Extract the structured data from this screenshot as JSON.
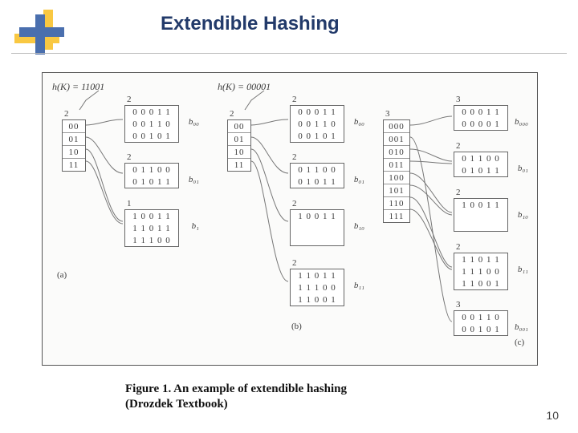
{
  "title": "Extendible Hashing",
  "caption_line1": "Figure 1. An example of extendible hashing",
  "caption_line2": "(Drozdek Textbook)",
  "page_number": "10",
  "panelA": {
    "hk": "h(K) = 11001",
    "dir": {
      "depth": "2",
      "slots": [
        "00",
        "01",
        "10",
        "11"
      ]
    },
    "buckets": [
      {
        "depth": "2",
        "keys": [
          "0 0 0 1 1",
          "0 0 1 1 0",
          "0 0 1 0 1"
        ],
        "label": "b₀₀"
      },
      {
        "depth": "2",
        "keys": [
          "0 1 1 0 0",
          "0 1 0 1 1"
        ],
        "label": "b₀₁"
      },
      {
        "depth": "1",
        "keys": [
          "1 0 0 1 1",
          "1 1 0 1 1",
          "1 1 1 0 0"
        ],
        "label": "b₁"
      }
    ],
    "subfig": "(a)"
  },
  "panelB": {
    "hk": "h(K) = 00001",
    "dir": {
      "depth": "2",
      "slots": [
        "00",
        "01",
        "10",
        "11"
      ]
    },
    "buckets": [
      {
        "depth": "2",
        "keys": [
          "0 0 0 1 1",
          "0 0 1 1 0",
          "0 0 1 0 1"
        ],
        "label": "b₀₀"
      },
      {
        "depth": "2",
        "keys": [
          "0 1 1 0 0",
          "0 1 0 1 1"
        ],
        "label": "b₀₁"
      },
      {
        "depth": "2",
        "keys": [
          "1 0 0 1 1"
        ],
        "label": "b₁₀"
      },
      {
        "depth": "2",
        "keys": [
          "1 1 0 1 1",
          "1 1 1 0 0",
          "1 1 0 0 1"
        ],
        "label": "b₁₁"
      }
    ],
    "subfig": "(b)"
  },
  "panelC": {
    "dir": {
      "depth": "3",
      "slots": [
        "000",
        "001",
        "010",
        "011",
        "100",
        "101",
        "110",
        "111"
      ]
    },
    "buckets": [
      {
        "depth": "3",
        "keys": [
          "0 0 0 1 1",
          "0 0 0 0 1"
        ],
        "label": "b₀₀₀"
      },
      {
        "depth": "2",
        "keys": [
          "0 1 1 0 0",
          "0 1 0 1 1"
        ],
        "label": "b₀₁"
      },
      {
        "depth": "2",
        "keys": [
          "1 0 0 1 1"
        ],
        "label": "b₁₀"
      },
      {
        "depth": "2",
        "keys": [
          "1 1 0 1 1",
          "1 1 1 0 0",
          "1 1 0 0 1"
        ],
        "label": "b₁₁"
      },
      {
        "depth": "3",
        "keys": [
          "0 0 1 1 0",
          "0 0 1 0 1"
        ],
        "label": "b₀₀₁"
      }
    ],
    "subfig": "(c)"
  }
}
